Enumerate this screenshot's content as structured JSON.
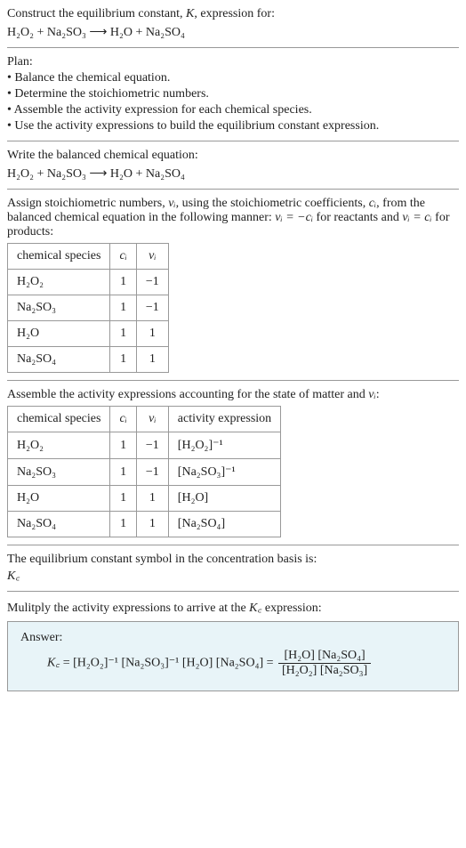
{
  "header": {
    "construct_text": "Construct the equilibrium constant, ",
    "K": "K",
    "expression_for": ", expression for:",
    "equation": "H₂O₂ + Na₂SO₃  ⟶  H₂O + Na₂SO₄"
  },
  "plan": {
    "title": "Plan:",
    "items": [
      "• Balance the chemical equation.",
      "• Determine the stoichiometric numbers.",
      "• Assemble the activity expression for each chemical species.",
      "• Use the activity expressions to build the equilibrium constant expression."
    ]
  },
  "balanced": {
    "title": "Write the balanced chemical equation:",
    "equation": "H₂O₂ + Na₂SO₃  ⟶  H₂O + Na₂SO₄"
  },
  "assign": {
    "text1": "Assign stoichiometric numbers, ",
    "nu_i": "νᵢ",
    "text2": ", using the stoichiometric coefficients, ",
    "c_i": "cᵢ",
    "text3": ", from the balanced chemical equation in the following manner: ",
    "eq1": "νᵢ = −cᵢ",
    "text4": " for reactants and ",
    "eq2": "νᵢ = cᵢ",
    "text5": " for products:",
    "table": {
      "headers": [
        "chemical species",
        "cᵢ",
        "νᵢ"
      ],
      "rows": [
        [
          "H₂O₂",
          "1",
          "−1"
        ],
        [
          "Na₂SO₃",
          "1",
          "−1"
        ],
        [
          "H₂O",
          "1",
          "1"
        ],
        [
          "Na₂SO₄",
          "1",
          "1"
        ]
      ]
    }
  },
  "activity": {
    "text1": "Assemble the activity expressions accounting for the state of matter and ",
    "nu_i": "νᵢ",
    "text2": ":",
    "table": {
      "headers": [
        "chemical species",
        "cᵢ",
        "νᵢ",
        "activity expression"
      ],
      "rows": [
        [
          "H₂O₂",
          "1",
          "−1",
          "[H₂O₂]⁻¹"
        ],
        [
          "Na₂SO₃",
          "1",
          "−1",
          "[Na₂SO₃]⁻¹"
        ],
        [
          "H₂O",
          "1",
          "1",
          "[H₂O]"
        ],
        [
          "Na₂SO₄",
          "1",
          "1",
          "[Na₂SO₄]"
        ]
      ]
    }
  },
  "symbol": {
    "text": "The equilibrium constant symbol in the concentration basis is:",
    "kc": "K꜀"
  },
  "multiply": {
    "text1": "Mulitply the activity expressions to arrive at the ",
    "kc": "K꜀",
    "text2": " expression:"
  },
  "answer": {
    "label": "Answer:",
    "kc": "K꜀",
    "equals": " = ",
    "expr": "[H₂O₂]⁻¹ [Na₂SO₃]⁻¹ [H₂O] [Na₂SO₄] = ",
    "frac_top": "[H₂O] [Na₂SO₄]",
    "frac_bot": "[H₂O₂] [Na₂SO₃]"
  },
  "chart_data": {
    "type": "table",
    "tables": [
      {
        "title": "Stoichiometric numbers",
        "headers": [
          "chemical species",
          "cᵢ",
          "νᵢ"
        ],
        "rows": [
          {
            "chemical species": "H₂O₂",
            "cᵢ": 1,
            "νᵢ": -1
          },
          {
            "chemical species": "Na₂SO₃",
            "cᵢ": 1,
            "νᵢ": -1
          },
          {
            "chemical species": "H₂O",
            "cᵢ": 1,
            "νᵢ": 1
          },
          {
            "chemical species": "Na₂SO₄",
            "cᵢ": 1,
            "νᵢ": 1
          }
        ]
      },
      {
        "title": "Activity expressions",
        "headers": [
          "chemical species",
          "cᵢ",
          "νᵢ",
          "activity expression"
        ],
        "rows": [
          {
            "chemical species": "H₂O₂",
            "cᵢ": 1,
            "νᵢ": -1,
            "activity expression": "[H₂O₂]⁻¹"
          },
          {
            "chemical species": "Na₂SO₃",
            "cᵢ": 1,
            "νᵢ": -1,
            "activity expression": "[Na₂SO₃]⁻¹"
          },
          {
            "chemical species": "H₂O",
            "cᵢ": 1,
            "νᵢ": 1,
            "activity expression": "[H₂O]"
          },
          {
            "chemical species": "Na₂SO₄",
            "cᵢ": 1,
            "νᵢ": 1,
            "activity expression": "[Na₂SO₄]"
          }
        ]
      }
    ]
  }
}
